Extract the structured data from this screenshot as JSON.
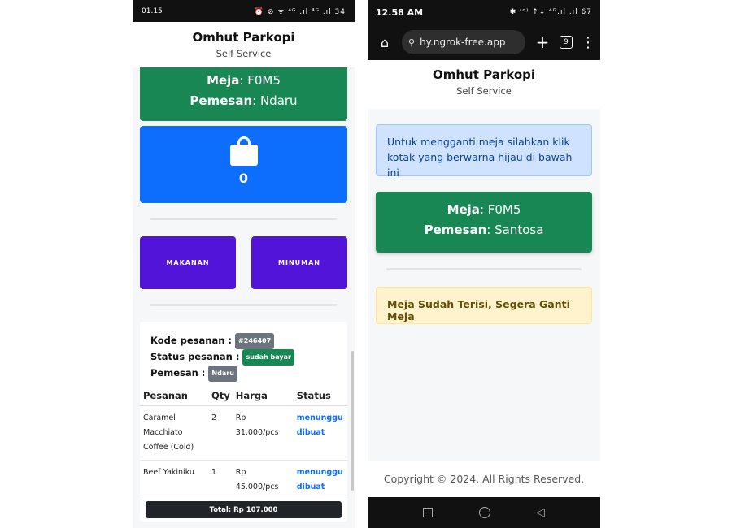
{
  "phone1": {
    "status": {
      "time": "01.15",
      "icons": "⏰ ⊘ ᯤ ⁴ᴳ .ıl ⁴ᴳ .ıl 34"
    },
    "header": {
      "brand": "Omhut Parkopi",
      "tagline": "Self Service"
    },
    "table_card": {
      "meja_label": "Meja",
      "meja_value": ": F0M5",
      "pemesan_label": "Pemesan",
      "pemesan_value": ": Ndaru"
    },
    "cart": {
      "icon": "shopping-bag-icon",
      "count": "0"
    },
    "categories": [
      {
        "label": "MAKANAN"
      },
      {
        "label": "MINUMAN"
      }
    ],
    "order": {
      "kode_label": "Kode pesanan :",
      "kode_value": "#246407",
      "status_label": "Status pesanan :",
      "status_value": "sudah bayar",
      "pemesan_label": "Pemesan :",
      "pemesan_value": "Ndaru",
      "columns": [
        "Pesanan",
        "Qty",
        "Harga",
        "Status"
      ],
      "rows": [
        {
          "name": "Caramel Macchiato Coffee (Cold)",
          "qty": "2",
          "price": "Rp 31.000/pcs",
          "status": "menunggu dibuat"
        },
        {
          "name": "Beef Yakiniku",
          "qty": "1",
          "price": "Rp 45.000/pcs",
          "status": "menunggu dibuat"
        }
      ],
      "total": "Total: Rp 107.000"
    }
  },
  "phone2": {
    "status": {
      "time": "12.58 AM",
      "icons": "✱ ⁽ᵒ⁾ ↑↓ ⁴ᴳ.ıl .ıl 67"
    },
    "browser": {
      "url": "hy.ngrok-free.app",
      "tab_count": "9"
    },
    "header": {
      "brand": "Omhut Parkopi",
      "tagline": "Self Service"
    },
    "info": "Untuk mengganti meja silahkan klik kotak yang berwarna hijau di bawah ini",
    "table_card": {
      "meja_label": "Meja",
      "meja_value": ": F0M5",
      "pemesan_label": "Pemesan",
      "pemesan_value": ": Santosa"
    },
    "warning": "Meja Sudah Terisi, Segera Ganti Meja",
    "footer": "Copyright © 2024. All Rights Reserved."
  },
  "colors": {
    "green": "#198754",
    "blue": "#0d6efd",
    "purple": "#5214d8",
    "dark": "#212529"
  }
}
